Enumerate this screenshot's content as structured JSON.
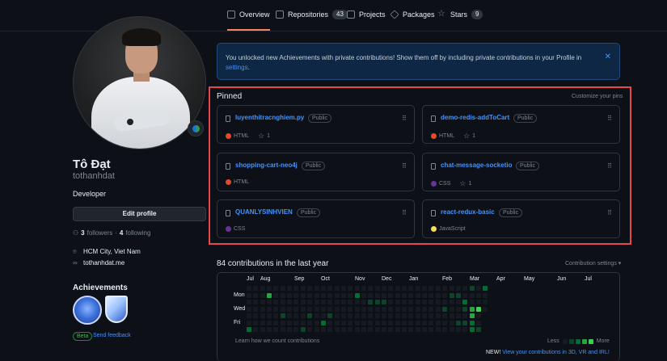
{
  "tabs": [
    {
      "label": "Overview",
      "icon": "book-icon",
      "count": null,
      "active": true
    },
    {
      "label": "Repositories",
      "icon": "repo-icon",
      "count": "43"
    },
    {
      "label": "Projects",
      "icon": "table-icon",
      "count": null
    },
    {
      "label": "Packages",
      "icon": "package-icon",
      "count": null
    },
    {
      "label": "Stars",
      "icon": "star-icon",
      "count": "9"
    }
  ],
  "profile": {
    "fullname": "Tô Đạt",
    "username": "tothanhdat",
    "bio": "Developer",
    "edit_label": "Edit profile",
    "followers_count": "3",
    "followers_label": "followers",
    "following_count": "4",
    "following_label": "following",
    "location": "HCM City, Viet Nam",
    "website": "tothanhdat.me"
  },
  "achievements": {
    "title": "Achievements",
    "beta_label": "Beta",
    "feedback_label": "Send feedback"
  },
  "notice": {
    "text": "You unlocked new Achievements with private contributions! Show them off by including private contributions in your Profile in",
    "link": "settings",
    "suffix": "."
  },
  "pinned": {
    "title": "Pinned",
    "customize_label": "Customize your pins",
    "repos": [
      {
        "name": "luyenthitracnghiem.py",
        "visibility": "Public",
        "language": "HTML",
        "lang_color": "#e34c26",
        "stars": "1"
      },
      {
        "name": "demo-redis-addToCart",
        "visibility": "Public",
        "language": "HTML",
        "lang_color": "#e34c26",
        "stars": "1"
      },
      {
        "name": "shopping-cart-neo4j",
        "visibility": "Public",
        "language": "HTML",
        "lang_color": "#e34c26",
        "stars": null
      },
      {
        "name": "chat-message-socketio",
        "visibility": "Public",
        "language": "CSS",
        "lang_color": "#663399",
        "stars": "1"
      },
      {
        "name": "QUANLYSINHVIEN",
        "visibility": "Public",
        "language": "CSS",
        "lang_color": "#663399",
        "stars": null
      },
      {
        "name": "react-redux-basic",
        "visibility": "Public",
        "language": "JavaScript",
        "lang_color": "#f1e05a",
        "stars": null
      }
    ]
  },
  "contributions": {
    "title": "84 contributions in the last year",
    "settings_label": "Contribution settings ▾",
    "months": [
      "Jul",
      "Aug",
      "Sep",
      "Oct",
      "Nov",
      "Dec",
      "Jan",
      "Feb",
      "Mar",
      "Apr",
      "May",
      "Jun",
      "Jul"
    ],
    "days": [
      "Mon",
      "Wed",
      "Fri"
    ],
    "learn_label": "Learn how we count contributions",
    "less_label": "Less",
    "more_label": "More",
    "new_prefix": "NEW!",
    "new_link": "View your contributions in 3D, VR and IRL!",
    "colors": [
      "#161b22",
      "#0e4429",
      "#006d32",
      "#26a641",
      "#39d353"
    ]
  }
}
